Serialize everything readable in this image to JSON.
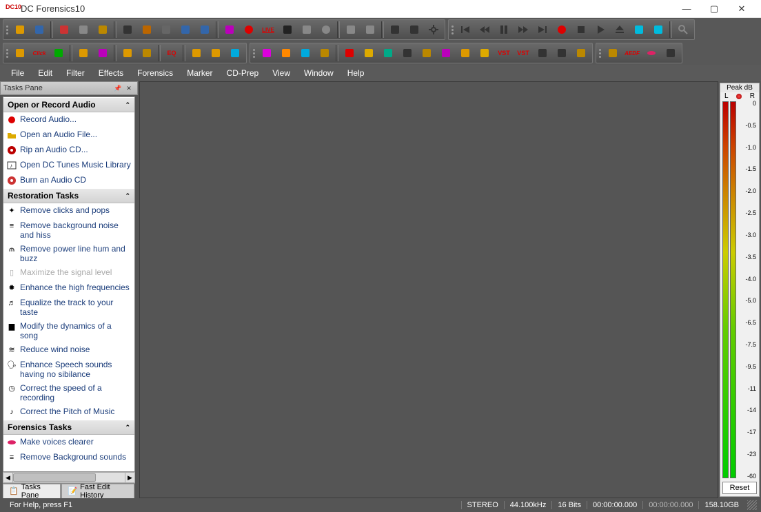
{
  "app": {
    "title": "DC Forensics10",
    "icon_label": "DC10"
  },
  "window_controls": {
    "min": "—",
    "max": "▢",
    "close": "✕"
  },
  "menu": [
    "File",
    "Edit",
    "Filter",
    "Effects",
    "Forensics",
    "Marker",
    "CD-Prep",
    "View",
    "Window",
    "Help"
  ],
  "tasks_pane": {
    "title": "Tasks Pane",
    "sections": [
      {
        "title": "Open or Record Audio",
        "items": [
          {
            "icon": "record-icon",
            "label": "Record Audio..."
          },
          {
            "icon": "open-file-icon",
            "label": "Open an Audio File..."
          },
          {
            "icon": "rip-cd-icon",
            "label": "Rip an Audio CD..."
          },
          {
            "icon": "music-library-icon",
            "label": "Open DC Tunes Music Library"
          },
          {
            "icon": "burn-cd-icon",
            "label": "Burn an Audio CD"
          }
        ]
      },
      {
        "title": "Restoration Tasks",
        "items": [
          {
            "icon": "declick-icon",
            "label": "Remove clicks and pops"
          },
          {
            "icon": "denoise-icon",
            "label": "Remove background noise and hiss"
          },
          {
            "icon": "dehum-icon",
            "label": "Remove power line hum and buzz"
          },
          {
            "icon": "maximize-icon",
            "label": "Maximize the signal level",
            "disabled": true
          },
          {
            "icon": "enhance-high-icon",
            "label": "Enhance the high frequencies"
          },
          {
            "icon": "equalize-icon",
            "label": "Equalize the track to your taste"
          },
          {
            "icon": "dynamics-icon",
            "label": "Modify the dynamics of a song"
          },
          {
            "icon": "wind-icon",
            "label": "Reduce wind noise"
          },
          {
            "icon": "speech-icon",
            "label": "Enhance Speech sounds having no sibilance"
          },
          {
            "icon": "speed-icon",
            "label": "Correct the speed of a recording"
          },
          {
            "icon": "pitch-icon",
            "label": "Correct the Pitch of Music"
          }
        ]
      },
      {
        "title": "Forensics Tasks",
        "items": [
          {
            "icon": "voice-clear-icon",
            "label": "Make voices clearer"
          },
          {
            "icon": "remove-bg-icon",
            "label": "Remove Background sounds"
          }
        ]
      }
    ],
    "bottom_tabs": [
      {
        "label": "Tasks Pane",
        "active": true
      },
      {
        "label": "Fast Edit History",
        "active": false
      }
    ]
  },
  "peak_meter": {
    "title": "Peak dB",
    "left_label": "L",
    "right_label": "R",
    "db_labels": [
      "0",
      "-0.5",
      "-1.0",
      "-1.5",
      "-2.0",
      "-2.5",
      "-3.0",
      "-3.5",
      "-4.0",
      "-5.0",
      "-6.5",
      "-7.5",
      "-9.5",
      "-11",
      "-14",
      "-17",
      "-23",
      "-60"
    ],
    "reset_label": "Reset"
  },
  "statusbar": {
    "help": "For Help, press F1",
    "channels": "STEREO",
    "sample_rate": "44.100kHz",
    "bits": "16 Bits",
    "time1": "00:00:00.000",
    "time2": "00:00:00.000",
    "disk": "158.10GB"
  },
  "toolbar_icons_row1": [
    "open",
    "save",
    "",
    "delete",
    "copy",
    "paste",
    "",
    "declick",
    "edit",
    "mute",
    "undo",
    "redo",
    "",
    "tune",
    "record",
    "live",
    "swirl",
    "levels",
    "record2",
    "",
    "fade1",
    "fade2",
    "",
    "cols",
    "cols2",
    "gear"
  ],
  "toolbar_icons_row1b": [
    "prev",
    "rew",
    "pause",
    "fwd",
    "next",
    "rec",
    "stop",
    "play",
    "eject",
    "tools",
    "tools2",
    "",
    "zoom"
  ],
  "toolbar_icons_row2": [
    "open2",
    "click",
    "pulse",
    "",
    "display",
    "spectrum",
    "",
    "export",
    "book",
    "",
    "eq",
    "",
    "hier",
    "tree",
    "waves"
  ],
  "toolbar_icons_row2b": [
    "diamond",
    "colors",
    "bars",
    "atom",
    "",
    "redbars",
    "cup",
    "grid",
    "target",
    "wand",
    "swatch",
    "balance",
    "star",
    "vst",
    "vst2",
    "swap",
    "bass",
    "scale"
  ],
  "toolbar_icons_row2c": [
    "justice",
    "aeda",
    "lips",
    "m1"
  ]
}
